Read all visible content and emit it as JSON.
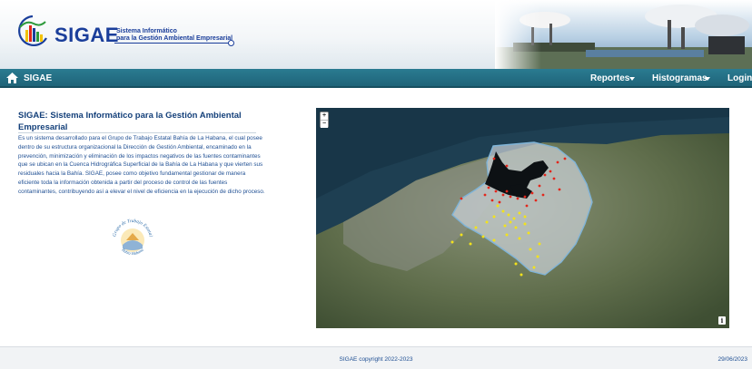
{
  "header": {
    "brand": "SIGAE",
    "subtitle_line1": "Sistema Informático",
    "subtitle_line2": "para la Gestión Ambiental Empresarial"
  },
  "nav": {
    "home_label": "SIGAE",
    "items": [
      {
        "label": "Reportes",
        "has_dropdown": true
      },
      {
        "label": "Histogramas",
        "has_dropdown": true
      },
      {
        "label": "Login",
        "has_dropdown": false
      }
    ]
  },
  "intro": {
    "title": "SIGAE: Sistema Informático para la Gestión Ambiental Empresarial",
    "body": "Es un sistema desarrollado para el Grupo de Trabajo Estatal Bahía de La Habana, el cual posee dentro de su estructura organizacional la Dirección de Gestión Ambiental, encaminado en la prevención, minimización y eliminación de los impactos negativos de las fuentes contaminantes que se ubican en la Cuenca Hidrográfica Superficial de la Bahía de La Habana y que vierten sus residuales hacia la Bahía. SIGAE, posee como objetivo fundamental gestionar de manera eficiente toda la información obtenida a partir del proceso de control de las fuentes contaminantes, contribuyendo así a elevar el nivel de eficiencia en la ejecución de dicho proceso.",
    "seal_text_top": "Grupo de Trabajo Estatal",
    "seal_text_bottom": "Bahía Habana"
  },
  "map": {
    "zoom_in": "+",
    "zoom_out": "−",
    "info": "i",
    "marker_colors": {
      "red": "#e3261b",
      "yellow": "#f2e21c"
    }
  },
  "footer": {
    "copyright": "SIGAE copyright 2022-2023",
    "date": "29/06/2023"
  }
}
